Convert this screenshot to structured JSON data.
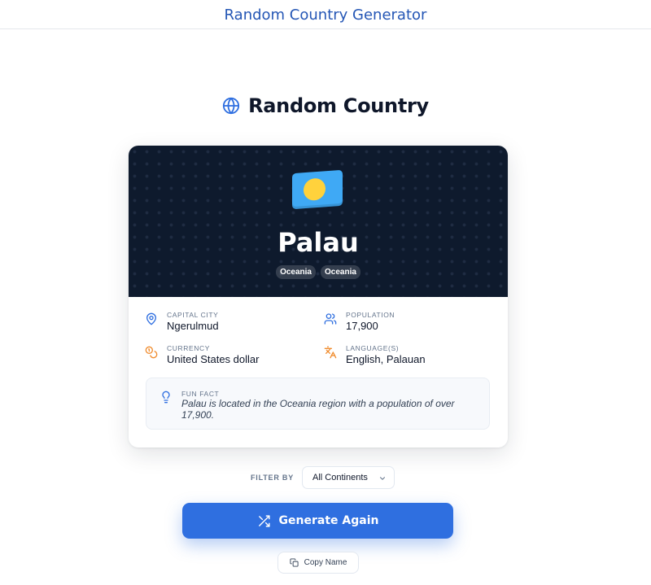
{
  "app_title": "Random Country Generator",
  "heading": {
    "text": "Random Country",
    "icon": "globe-icon"
  },
  "country": {
    "flag_icon": "palau-flag-icon",
    "name": "Palau",
    "badges": [
      "Oceania",
      "Oceania"
    ],
    "info": [
      {
        "label": "CAPITAL CITY",
        "value": "Ngerulmud",
        "icon": "map-pin-icon"
      },
      {
        "label": "POPULATION",
        "value": "17,900",
        "icon": "users-icon"
      },
      {
        "label": "CURRENCY",
        "value": "United States dollar",
        "icon": "coins-icon"
      },
      {
        "label": "LANGUAGE(S)",
        "value": "English, Palauan",
        "icon": "translate-icon"
      }
    ],
    "fun_fact": {
      "label": "FUN FACT",
      "text": "Palau is located in the Oceania region with a population of over 17,900.",
      "icon": "lightbulb-icon"
    }
  },
  "filter": {
    "label": "FILTER BY",
    "selected": "All Continents",
    "icon": "chevron-down-icon"
  },
  "generate_button": {
    "label": "Generate Again",
    "icon": "shuffle-icon"
  },
  "copy_button": {
    "label": "Copy Name",
    "icon": "copy-icon"
  },
  "colors": {
    "accent": "#2f6fe0",
    "title": "#2456b5",
    "hero_bg": "#0e1a2d",
    "flag_blue": "#3fa9f5",
    "flag_disc": "#ffd23c"
  }
}
